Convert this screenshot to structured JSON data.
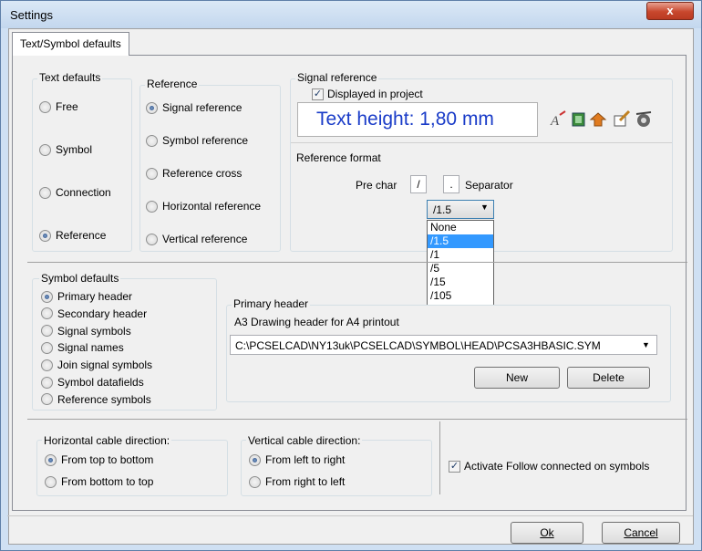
{
  "window": {
    "title": "Settings",
    "close_glyph": "x"
  },
  "tabs": [
    "Text/Symbol defaults"
  ],
  "text_defaults": {
    "title": "Text defaults",
    "options": [
      {
        "label": "Free",
        "selected": false
      },
      {
        "label": "Symbol",
        "selected": false
      },
      {
        "label": "Connection",
        "selected": false
      },
      {
        "label": "Reference",
        "selected": true
      }
    ]
  },
  "reference": {
    "title": "Reference",
    "options": [
      {
        "label": "Signal reference",
        "selected": true
      },
      {
        "label": "Symbol reference",
        "selected": false
      },
      {
        "label": "Reference cross",
        "selected": false
      },
      {
        "label": "Horizontal reference",
        "selected": false
      },
      {
        "label": "Vertical reference",
        "selected": false
      }
    ]
  },
  "signal_reference": {
    "title": "Signal reference",
    "displayed_label": "Displayed in project",
    "displayed_checked": true,
    "text_height": "Text height: 1,80 mm",
    "toolbar_icons": [
      "text-size-icon",
      "color-icon",
      "move-icon",
      "edit-icon",
      "visibility-icon"
    ]
  },
  "reference_format": {
    "title": "Reference format",
    "pre_char_label": "Pre char",
    "pre_char_value": "/",
    "separator_value": ".",
    "separator_label": "Separator",
    "format_selected": "/1.5",
    "format_options": [
      "None",
      "/1.5",
      "/1",
      "/5",
      "/15",
      "/105"
    ],
    "highlighted_index": 1
  },
  "symbol_defaults": {
    "title": "Symbol defaults",
    "options": [
      {
        "label": "Primary header",
        "selected": true
      },
      {
        "label": "Secondary header",
        "selected": false
      },
      {
        "label": "Signal symbols",
        "selected": false
      },
      {
        "label": "Signal names",
        "selected": false
      },
      {
        "label": "Join signal symbols",
        "selected": false
      },
      {
        "label": "Symbol datafields",
        "selected": false
      },
      {
        "label": "Reference symbols",
        "selected": false
      }
    ]
  },
  "primary_header": {
    "title": "Primary header",
    "description": "A3 Drawing header for A4 printout",
    "path": "C:\\PCSELCAD\\NY13uk\\PCSELCAD\\SYMBOL\\HEAD\\PCSA3HBASIC.SYM",
    "new_label": "New",
    "delete_label": "Delete"
  },
  "horizontal_cable": {
    "title": "Horizontal cable direction:",
    "options": [
      {
        "label": "From top to bottom",
        "selected": true
      },
      {
        "label": "From bottom to top",
        "selected": false
      }
    ]
  },
  "vertical_cable": {
    "title": "Vertical cable direction:",
    "options": [
      {
        "label": "From left to right",
        "selected": true
      },
      {
        "label": "From right to left",
        "selected": false
      }
    ]
  },
  "follow_connected": {
    "label": "Activate Follow connected on symbols",
    "checked": true
  },
  "footer": {
    "ok_label": "Ok",
    "cancel_label": "Cancel"
  },
  "colors": {
    "text_height": "#1a3cc8",
    "highlight": "#3399ff"
  }
}
